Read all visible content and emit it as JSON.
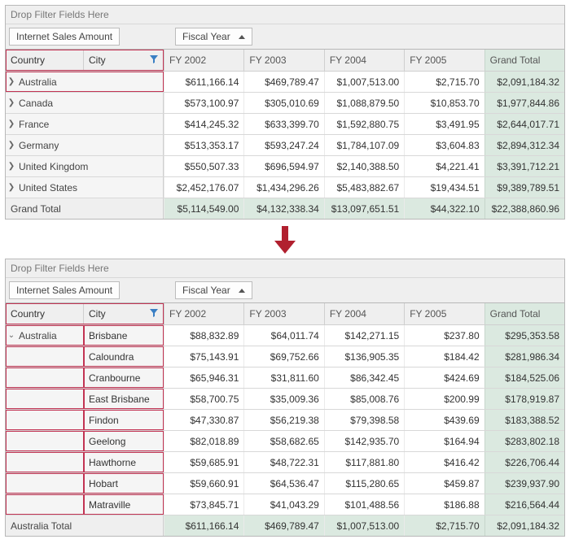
{
  "filterDropText": "Drop Filter Fields Here",
  "dataPill": "Internet Sales Amount",
  "colPill": "Fiscal Year",
  "rowPillCountry": "Country",
  "rowPillCity": "City",
  "columns": [
    "FY 2002",
    "FY 2003",
    "FY 2004",
    "FY 2005"
  ],
  "grandTotalLabel": "Grand Total",
  "top": {
    "rows": [
      {
        "label": "Australia",
        "v": [
          "$611,166.14",
          "$469,789.47",
          "$1,007,513.00",
          "$2,715.70",
          "$2,091,184.32"
        ]
      },
      {
        "label": "Canada",
        "v": [
          "$573,100.97",
          "$305,010.69",
          "$1,088,879.50",
          "$10,853.70",
          "$1,977,844.86"
        ]
      },
      {
        "label": "France",
        "v": [
          "$414,245.32",
          "$633,399.70",
          "$1,592,880.75",
          "$3,491.95",
          "$2,644,017.71"
        ]
      },
      {
        "label": "Germany",
        "v": [
          "$513,353.17",
          "$593,247.24",
          "$1,784,107.09",
          "$3,604.83",
          "$2,894,312.34"
        ]
      },
      {
        "label": "United Kingdom",
        "v": [
          "$550,507.33",
          "$696,594.97",
          "$2,140,388.50",
          "$4,221.41",
          "$3,391,712.21"
        ]
      },
      {
        "label": "United States",
        "v": [
          "$2,452,176.07",
          "$1,434,296.26",
          "$5,483,882.67",
          "$19,434.51",
          "$9,389,789.51"
        ]
      }
    ],
    "grand": [
      "$5,114,549.00",
      "$4,132,338.34",
      "$13,097,651.51",
      "$44,322.10",
      "$22,388,860.96"
    ]
  },
  "bottom": {
    "country": "Australia",
    "cities": [
      {
        "label": "Brisbane",
        "v": [
          "$88,832.89",
          "$64,011.74",
          "$142,271.15",
          "$237.80",
          "$295,353.58"
        ]
      },
      {
        "label": "Caloundra",
        "v": [
          "$75,143.91",
          "$69,752.66",
          "$136,905.35",
          "$184.42",
          "$281,986.34"
        ]
      },
      {
        "label": "Cranbourne",
        "v": [
          "$65,946.31",
          "$31,811.60",
          "$86,342.45",
          "$424.69",
          "$184,525.06"
        ]
      },
      {
        "label": "East Brisbane",
        "v": [
          "$58,700.75",
          "$35,009.36",
          "$85,008.76",
          "$200.99",
          "$178,919.87"
        ]
      },
      {
        "label": "Findon",
        "v": [
          "$47,330.87",
          "$56,219.38",
          "$79,398.58",
          "$439.69",
          "$183,388.52"
        ]
      },
      {
        "label": "Geelong",
        "v": [
          "$82,018.89",
          "$58,682.65",
          "$142,935.70",
          "$164.94",
          "$283,802.18"
        ]
      },
      {
        "label": "Hawthorne",
        "v": [
          "$59,685.91",
          "$48,722.31",
          "$117,881.80",
          "$416.42",
          "$226,706.44"
        ]
      },
      {
        "label": "Hobart",
        "v": [
          "$59,660.91",
          "$64,536.47",
          "$115,280.65",
          "$459.87",
          "$239,937.90"
        ]
      },
      {
        "label": "Matraville",
        "v": [
          "$73,845.71",
          "$41,043.29",
          "$101,488.56",
          "$186.88",
          "$216,564.44"
        ]
      }
    ],
    "subtotalLabel": "Australia Total",
    "subtotal": [
      "$611,166.14",
      "$469,789.47",
      "$1,007,513.00",
      "$2,715.70",
      "$2,091,184.32"
    ]
  }
}
